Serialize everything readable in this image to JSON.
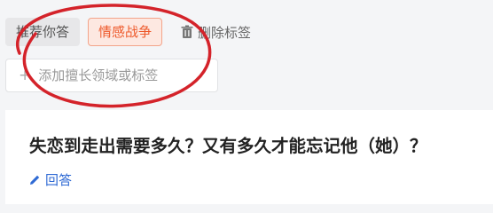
{
  "tags": {
    "recommended_label": "推荐你答",
    "active_label": "情感战争",
    "delete_label": "删除标签"
  },
  "tag_input": {
    "placeholder": "添加擅长领域或标签"
  },
  "question": {
    "title": "失恋到走出需要多久？又有多久才能忘记他（她）？",
    "answer_label": "回答"
  },
  "icons": {
    "delete": "trash-icon",
    "add": "plus-icon",
    "answer": "pencil-icon"
  },
  "colors": {
    "active_tag_text": "#ee5a2c",
    "active_tag_bg": "#fde8e1",
    "link": "#2f6ad4",
    "annotation": "#d4232a"
  }
}
